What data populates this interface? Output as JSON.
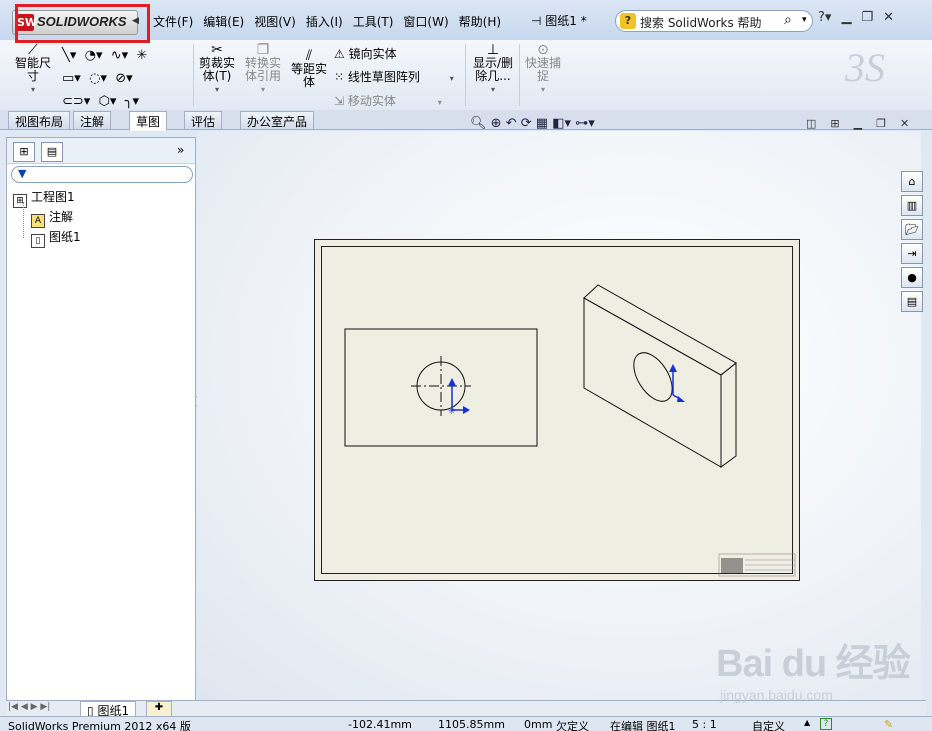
{
  "app": {
    "logo_text": "SOLIDWORKS",
    "logo_badge": "SW",
    "document_title": "图纸1 *"
  },
  "menu": [
    "文件(F)",
    "编辑(E)",
    "视图(V)",
    "插入(I)",
    "工具(T)",
    "窗口(W)",
    "帮助(H)"
  ],
  "help_search": {
    "badge": "?",
    "placeholder": "搜索 SolidWorks 帮助"
  },
  "ribbon": {
    "smart_dim": "智能尺寸",
    "trim": "剪裁实体(T)",
    "convert": "转换实体引用",
    "offset": "等距实体",
    "mirror": "镜向实体",
    "linear_pattern": "线性草图阵列",
    "move": "移动实体",
    "show_hide": "显示/删除几...",
    "quick_snap": "快速捕捉"
  },
  "tabs": [
    "视图布局",
    "注解",
    "草图",
    "评估",
    "办公室产品"
  ],
  "active_tab": "草图",
  "tree": {
    "root": "工程图1",
    "annotations": "注解",
    "sheet": "图纸1"
  },
  "sheet_tab": "图纸1",
  "status": {
    "product": "SolidWorks Premium 2012 x64 版",
    "x": "-102.41mm",
    "y": "1105.85mm",
    "z": "0mm",
    "state": "欠定义",
    "editing": "在编辑 图纸1",
    "scale": "5 : 1",
    "units": "自定义"
  },
  "watermark": {
    "brand": "Bai du 经验",
    "url": "jingyan.baidu.com"
  },
  "colors": {
    "accent_red": "#e21e25",
    "sheet_bg": "#efeee2",
    "triad_blue": "#1a2fd8"
  }
}
